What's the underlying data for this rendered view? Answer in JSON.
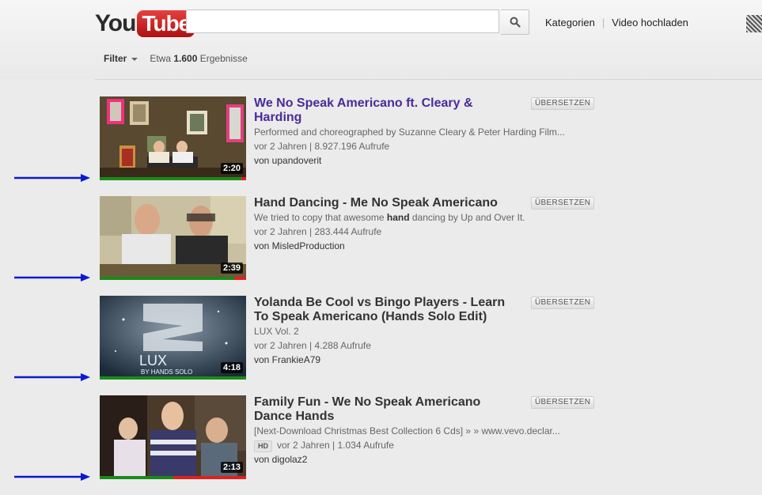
{
  "header": {
    "logo_you": "You",
    "logo_tube": "Tube",
    "search": {
      "value": "",
      "placeholder": ""
    },
    "links": [
      "Kategorien",
      "Video hochladen"
    ]
  },
  "filter": {
    "label": "Filter",
    "count_prefix": "Etwa",
    "count": "1.600",
    "count_suffix": "Ergebnisse"
  },
  "colors": {
    "watched_bar": "#1a8a1a",
    "unwatched_bar": "#e02020",
    "arrow": "#0a1ad0",
    "visited_link": "#4a2a9a"
  },
  "results": [
    {
      "title": "We No Speak Americano ft. Cleary & Harding",
      "description": "Performed and choreographed by Suzanne Cleary & Peter Harding Film...",
      "stats": "vor 2 Jahren | 8.927.196 Aufrufe",
      "author": "von upandoverit",
      "duration": "2:20",
      "translate": "ÜBERSETZEN",
      "watched_fraction": 0.97,
      "visited": true
    },
    {
      "title": "Hand Dancing - Me No Speak Americano",
      "description_pre": "We tried to copy that awesome ",
      "description_bold": "hand",
      "description_post": " dancing by Up and Over It.",
      "stats": "vor 2 Jahren | 283.444 Aufrufe",
      "author": "von MisledProduction",
      "duration": "2:39",
      "translate": "ÜBERSETZEN",
      "watched_fraction": 0.92,
      "visited": false
    },
    {
      "title": "Yolanda Be Cool vs Bingo Players - Learn To Speak Americano (Hands Solo Edit)",
      "description": "LUX Vol. 2",
      "stats": "vor 2 Jahren | 4.288 Aufrufe",
      "author": "von FrankieA79",
      "duration": "4:18",
      "translate": "ÜBERSETZEN",
      "watched_fraction": 1.0,
      "thumb_text_big": "LUX",
      "thumb_text_small": "BY HANDS SOLO",
      "visited": false
    },
    {
      "title": "Family Fun - We No Speak Americano Dance Hands",
      "description": "[Next-Download Christmas Best Collection 6 Cds] » » www.vevo.declar...",
      "hd": "HD",
      "stats": "vor 2 Jahren | 1.034 Aufrufe",
      "author": "von digolaz2",
      "duration": "2:13",
      "translate": "ÜBERSETZEN",
      "watched_fraction": 0.5,
      "visited": false
    }
  ]
}
